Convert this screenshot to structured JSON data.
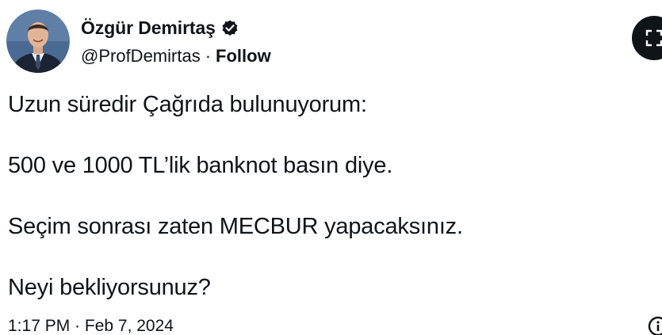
{
  "author": {
    "display_name": "Özgür Demirtaş",
    "handle": "@ProfDemirtas",
    "separator": "·",
    "follow_label": "Follow",
    "verified": true
  },
  "tweet": {
    "lines": [
      "Uzun süredir Çağrıda bulunuyorum:",
      "500 ve 1000 TL’lik banknot basın diye.",
      "Seçim sonrası zaten MECBUR yapacaksınız.",
      "Neyi bekliyorsunuz?"
    ],
    "timestamp": "1:17 PM · Feb 7, 2024"
  },
  "icons": {
    "verified": "verified-badge-icon",
    "more": "expand-icon",
    "info": "info-icon"
  },
  "colors": {
    "text": "#0f1419",
    "background": "#ffffff",
    "button": "#0f1419"
  }
}
